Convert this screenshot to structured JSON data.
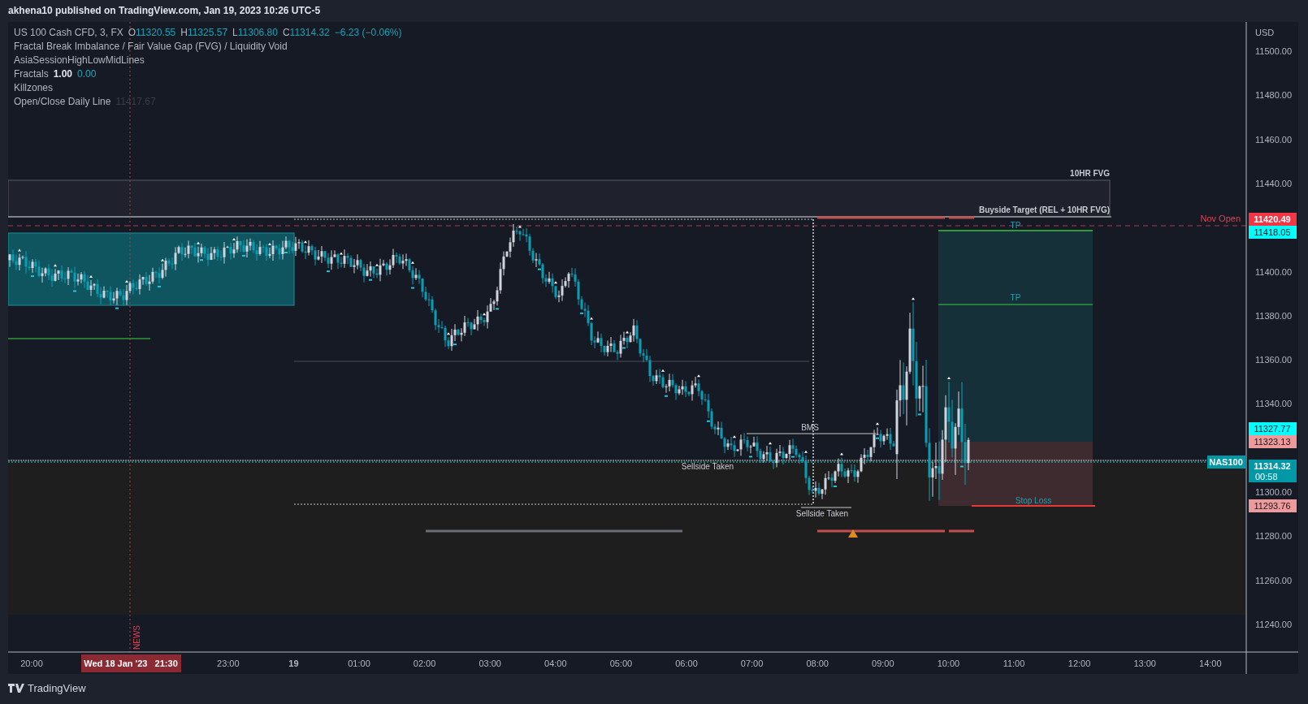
{
  "header": {
    "title": "akhena10 published on TradingView.com, Jan 19, 2023 10:26 UTC-5"
  },
  "legend": {
    "symbol": "US 100 Cash CFD, 3, FX",
    "ohlc": [
      {
        "label": "O",
        "value": "11320.55"
      },
      {
        "label": "H",
        "value": "11325.57"
      },
      {
        "label": "L",
        "value": "11306.80"
      },
      {
        "label": "C",
        "value": "11314.32"
      }
    ],
    "change": "−6.23 (−0.06%)",
    "indicators": [
      {
        "name": "Fractal Break Imbalance / Fair Value Gap (FVG) / Liquidity Void"
      },
      {
        "name": "AsiaSessionHighLowMidLines"
      },
      {
        "name": "Fractals",
        "values": [
          {
            "text": "1.00",
            "kind": "bold"
          },
          {
            "text": "0.00",
            "kind": "accent"
          }
        ]
      },
      {
        "name": "Killzones"
      },
      {
        "name": "Open/Close Daily Line",
        "values": [
          {
            "text": "11417.67",
            "kind": "dim"
          }
        ]
      }
    ]
  },
  "annotations": {
    "fvg_label": "10HR FVG",
    "buyside_label": "Buyside Target (REL + 10HR FVG)",
    "nov_open_label": "Nov Open",
    "tp_labels": [
      "TP",
      "TP"
    ],
    "stop_loss_label": "Stop Loss",
    "bms_label": "BMS",
    "sellside_labels": [
      "Sellside Taken",
      "Sellside Taken"
    ],
    "news_label": "NEWS",
    "symbol_tag": "NAS100"
  },
  "price_axis": {
    "currency": "USD",
    "ticks": [
      "11500.00",
      "11480.00",
      "11460.00",
      "11440.00",
      "11400.00",
      "11380.00",
      "11360.00",
      "11340.00",
      "11300.00",
      "11280.00",
      "11260.00",
      "11240.00"
    ],
    "markers": [
      {
        "value": "11420.49",
        "kind": "red"
      },
      {
        "value": "11418.05",
        "kind": "cyan"
      },
      {
        "value": "11327.77",
        "kind": "cyan"
      },
      {
        "value": "11323.13",
        "kind": "pink"
      },
      {
        "value": "11314.32",
        "kind": "teal",
        "countdown": "00:58"
      },
      {
        "value": "11293.76",
        "kind": "pink"
      }
    ]
  },
  "time_axis": {
    "labels": [
      {
        "text": "20:00",
        "bold": false
      },
      {
        "text": "23:00",
        "bold": false
      },
      {
        "text": "19",
        "bold": true
      },
      {
        "text": "01:00",
        "bold": false
      },
      {
        "text": "02:00",
        "bold": false
      },
      {
        "text": "03:00",
        "bold": false
      },
      {
        "text": "04:00",
        "bold": false
      },
      {
        "text": "05:00",
        "bold": false
      },
      {
        "text": "06:00",
        "bold": false
      },
      {
        "text": "07:00",
        "bold": false
      },
      {
        "text": "08:00",
        "bold": false
      },
      {
        "text": "09:00",
        "bold": false
      },
      {
        "text": "10:00",
        "bold": false
      },
      {
        "text": "11:00",
        "bold": false
      },
      {
        "text": "12:00",
        "bold": false
      },
      {
        "text": "13:00",
        "bold": false
      },
      {
        "text": "14:00",
        "bold": false
      }
    ],
    "cursor_label": "Wed 18 Jan '23   21:30"
  },
  "footer": {
    "brand": "TradingView"
  }
}
